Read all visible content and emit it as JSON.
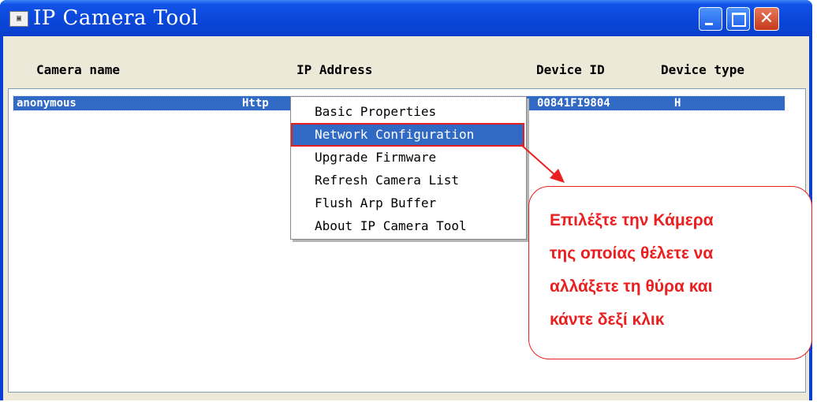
{
  "window": {
    "title": "IP Camera Tool",
    "app_icon": "camera-icon"
  },
  "columns": [
    "Camera name",
    "IP Address",
    "Device ID",
    "Device type"
  ],
  "camera_rows": [
    {
      "name": "anonymous",
      "ip_prefix": "Http",
      "device_id": "00841FI9804",
      "device_type": "H"
    }
  ],
  "context_menu": {
    "items": [
      "Basic Properties",
      "Network Configuration",
      "Upgrade Firmware",
      "Refresh Camera List",
      "Flush Arp Buffer",
      "About IP Camera Tool"
    ],
    "highlighted": "Network Configuration"
  },
  "callout": {
    "lines": [
      "Επιλέξτε την Κάμερα",
      "της οποίας θέλετε να",
      "αλλάξετε τη θύρα και",
      "κάντε δεξί κλικ"
    ],
    "color": "#ea1f1f"
  },
  "colors": {
    "titlebar": "#0a46d8",
    "selection": "#316ac5",
    "client": "#ece9d8"
  }
}
